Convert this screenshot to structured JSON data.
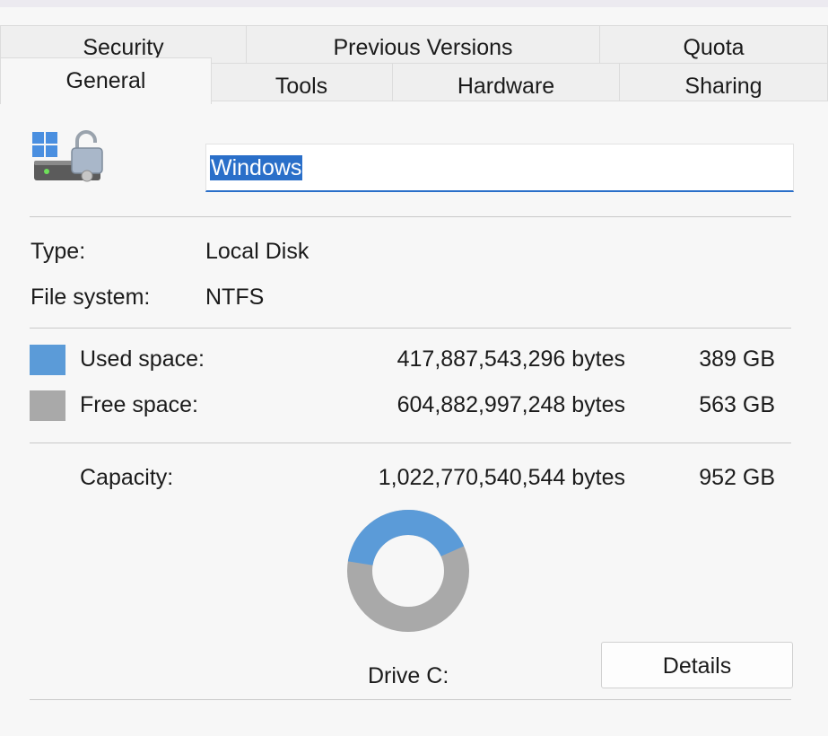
{
  "tabs": {
    "row1": [
      "Security",
      "Previous Versions",
      "Quota"
    ],
    "row2": [
      "General",
      "Tools",
      "Hardware",
      "Sharing"
    ],
    "active": "General"
  },
  "drive_name": "Windows",
  "info": {
    "type_label": "Type:",
    "type_value": "Local Disk",
    "fs_label": "File system:",
    "fs_value": "NTFS"
  },
  "space": {
    "used_label": "Used space:",
    "used_bytes": "417,887,543,296 bytes",
    "used_gb": "389 GB",
    "free_label": "Free space:",
    "free_bytes": "604,882,997,248 bytes",
    "free_gb": "563 GB",
    "capacity_label": "Capacity:",
    "capacity_bytes": "1,022,770,540,544 bytes",
    "capacity_gb": "952 GB",
    "used_fraction": 0.4086
  },
  "colors": {
    "used": "#5b9bd8",
    "free": "#a9a9a9",
    "accent": "#2a6fc9"
  },
  "drive_label": "Drive C:",
  "details_label": "Details",
  "icons": {
    "drive": "drive-with-windows-and-unlocked-padlock-icon"
  }
}
